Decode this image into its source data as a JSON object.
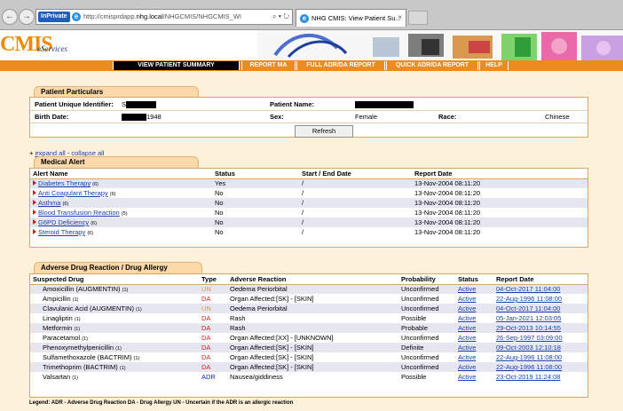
{
  "browser": {
    "inprivate": "InPrivate",
    "url_prefix": "http://cmisprdapp.",
    "url_host": "nhg.local",
    "url_suffix": "/NHGCMIS/NHGCMIS_WI",
    "addr_controls": "⌕ ▾ ↻",
    "tab_title": "NHG CMIS: View Patient Su...",
    "back_icon": "←",
    "fwd_icon": "→",
    "close_icon": "×"
  },
  "banner": {
    "logo": "CMIS",
    "subtitle": "eServices"
  },
  "nav": {
    "view_summary": "VIEW PATIENT SUMMARY",
    "report_ma": "REPORT MA",
    "full_adr": "FULL ADR/DA REPORT",
    "quick_adr": "QUICK ADR/DA REPORT",
    "help": "HELP"
  },
  "patient": {
    "section_title": "Patient Particulars",
    "uid_label": "Patient Unique Identifier:",
    "uid_value": "S",
    "name_label": "Patient Name:",
    "dob_label": "Birth Date:",
    "dob_value": "1948",
    "sex_label": "Sex:",
    "sex_value": "Female",
    "race_label": "Race:",
    "race_value": "Chinese",
    "refresh": "Refresh"
  },
  "expand": {
    "prefix": "+",
    "expand_all": "expand all",
    "sep": " - ",
    "collapse_all": "collapse all"
  },
  "medical_alert": {
    "section_title": "Medical Alert",
    "headers": [
      "Alert Name",
      "Status",
      "Start / End Date",
      "Report Date"
    ],
    "rows": [
      {
        "name": "Diabetes Therapy",
        "count": "(6)",
        "status": "Yes",
        "dates": "/",
        "report": "13-Nov-2004 08:11:20"
      },
      {
        "name": "Anti Coagulant Therapy",
        "count": "(6)",
        "status": "No",
        "dates": "/",
        "report": "13-Nov-2004 08:11:20"
      },
      {
        "name": "Asthma",
        "count": "(6)",
        "status": "No",
        "dates": "/",
        "report": "13-Nov-2004 08:11:20"
      },
      {
        "name": "Blood Transfusion Reaction",
        "count": "(5)",
        "status": "No",
        "dates": "/",
        "report": "13-Nov-2004 08:11:20"
      },
      {
        "name": "G6PD Deficiency",
        "count": "(6)",
        "status": "No",
        "dates": "/",
        "report": "13-Nov-2004 08:11:20"
      },
      {
        "name": "Steroid Therapy",
        "count": "(6)",
        "status": "No",
        "dates": "/",
        "report": "13-Nov-2004 08:11:20"
      }
    ]
  },
  "adr": {
    "section_title": "Adverse Drug Reaction / Drug Allergy",
    "headers": [
      "Suspected Drug",
      "Type",
      "Adverse Reaction",
      "Probability",
      "Status",
      "Report Date"
    ],
    "rows": [
      {
        "drug": "Amoxicillin (AUGMENTIN)",
        "count": "(1)",
        "type": "UN",
        "reaction": "Oedema Periorbital",
        "prob": "Unconfirmed",
        "status": "Active",
        "date": "04-Oct-2017 11:04:00"
      },
      {
        "drug": "Ampicillin",
        "count": "(1)",
        "type": "DA",
        "reaction": "Organ Affected:[SK] - [SKIN]",
        "prob": "Unconfirmed",
        "status": "Active",
        "date": "22-Aug-1996 11:08:00"
      },
      {
        "drug": "Clavulanic Acid (AUGMENTIN)",
        "count": "(1)",
        "type": "UN",
        "reaction": "Oedema Periorbital",
        "prob": "Unconfirmed",
        "status": "Active",
        "date": "04-Oct-2017 11:04:00"
      },
      {
        "drug": "Linagliptin",
        "count": "(1)",
        "type": "DA",
        "reaction": "Rash",
        "prob": "Possible",
        "status": "Active",
        "date": "05-Jan-2021 12:03:05"
      },
      {
        "drug": "Metformin",
        "count": "(1)",
        "type": "DA",
        "reaction": "Rash",
        "prob": "Probable",
        "status": "Active",
        "date": "29-Oct-2013 10:14:55"
      },
      {
        "drug": "Paracetamol",
        "count": "(1)",
        "type": "DA",
        "reaction": "Organ Affected:[XX] - [UNKNOWN]",
        "prob": "Unconfirmed",
        "status": "Active",
        "date": "26-Sep-1997 03:09:00"
      },
      {
        "drug": "Phenoxymethylpenicillin",
        "count": "(1)",
        "type": "DA",
        "reaction": "Organ Affected:[SK] - [SKIN]",
        "prob": "Definite",
        "status": "Active",
        "date": "09-Oct-2003 12:10:18"
      },
      {
        "drug": "Sulfamethoxazole (BACTRIM)",
        "count": "(1)",
        "type": "DA",
        "reaction": "Organ Affected:[SK] - [SKIN]",
        "prob": "Unconfirmed",
        "status": "Active",
        "date": "22-Aug-1996 11:08:00"
      },
      {
        "drug": "Trimethoprim (BACTRIM)",
        "count": "(1)",
        "type": "DA",
        "reaction": "Organ Affected:[SK] - [SKIN]",
        "prob": "Unconfirmed",
        "status": "Active",
        "date": "22-Aug-1996 11:08:00"
      },
      {
        "drug": "Valsartan",
        "count": "(1)",
        "type": "ADR",
        "reaction": "Nausea/giddiness",
        "prob": "Possible",
        "status": "Active",
        "date": "23-Oct-2019 11:24:08"
      }
    ]
  },
  "legend": "Legend: ADR - Adverse Drug Reaction   DA - Drug Allergy   UN - Uncertain if the ADR is an allergic reaction",
  "colors": {
    "nav_orange": "#ef8a1c",
    "type_un": "#e39a1c",
    "type_da": "#e21b1b",
    "type_adr": "#1a28c8",
    "link": "#1a3fb3"
  }
}
